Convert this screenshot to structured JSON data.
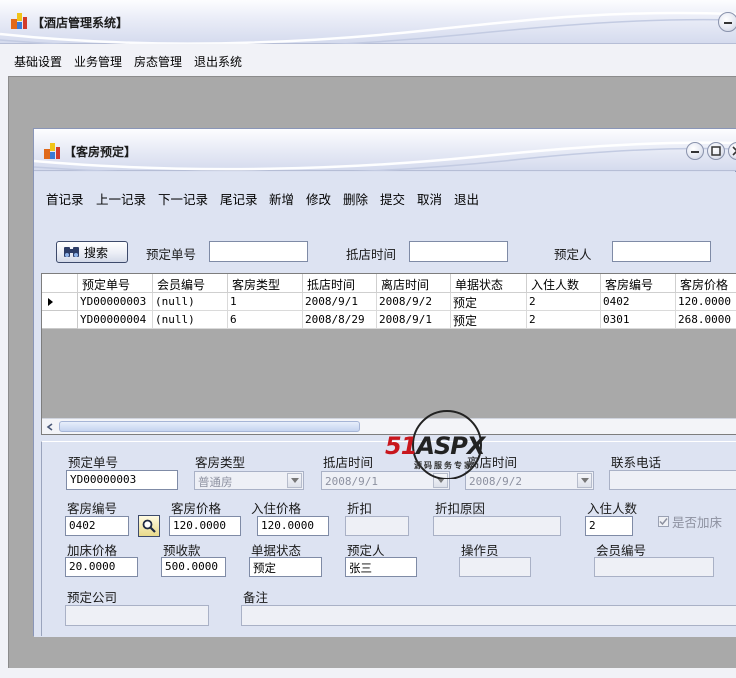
{
  "main_window": {
    "title": "【酒店管理系统】"
  },
  "menu": {
    "items": [
      "基础设置",
      "业务管理",
      "房态管理",
      "退出系统"
    ]
  },
  "child_window": {
    "title": "【客房预定】"
  },
  "toolbar": {
    "items": [
      "首记录",
      "上一记录",
      "下一记录",
      "尾记录",
      "新增",
      "修改",
      "删除",
      "提交",
      "取消",
      "退出"
    ]
  },
  "search": {
    "button_label": "搜索",
    "labels": {
      "booking_no": "预定单号",
      "checkin_time": "抵店时间",
      "booker": "预定人"
    },
    "values": {
      "booking_no": "",
      "checkin_time": "",
      "booker": ""
    }
  },
  "grid": {
    "columns": [
      "预定单号",
      "会员编号",
      "客房类型",
      "抵店时间",
      "离店时间",
      "单据状态",
      "入住人数",
      "客房编号",
      "客房价格"
    ],
    "rows": [
      {
        "cells": [
          "YD00000003",
          "(null)",
          "1",
          "2008/9/1",
          "2008/9/2",
          "预定",
          "2",
          "0402",
          "120.0000"
        ],
        "current": true
      },
      {
        "cells": [
          "YD00000004",
          "(null)",
          "6",
          "2008/8/29",
          "2008/9/1",
          "预定",
          "2",
          "0301",
          "268.0000"
        ],
        "current": false
      }
    ]
  },
  "detail": {
    "booking_no": {
      "label": "预定单号",
      "value": "YD00000003"
    },
    "room_type": {
      "label": "客房类型",
      "value": "普通房"
    },
    "checkin_time": {
      "label": "抵店时间",
      "value": "2008/9/1"
    },
    "checkout_time": {
      "label": "离店时间",
      "value": "2008/9/2"
    },
    "phone": {
      "label": "联系电话",
      "value": ""
    },
    "room_no": {
      "label": "客房编号",
      "value": "0402"
    },
    "room_price": {
      "label": "客房价格",
      "value": "120.0000"
    },
    "checkin_price": {
      "label": "入住价格",
      "value": "120.0000"
    },
    "discount": {
      "label": "折扣",
      "value": ""
    },
    "discount_reason": {
      "label": "折扣原因",
      "value": ""
    },
    "guest_count": {
      "label": "入住人数",
      "value": "2"
    },
    "extra_bed": {
      "label": "是否加床",
      "checked": true
    },
    "extra_bed_price": {
      "label": "加床价格",
      "value": "20.0000"
    },
    "prepaid": {
      "label": "预收款",
      "value": "500.0000"
    },
    "status": {
      "label": "单据状态",
      "value": "预定"
    },
    "booker": {
      "label": "预定人",
      "value": "张三"
    },
    "operator": {
      "label": "操作员",
      "value": ""
    },
    "member_no": {
      "label": "会员编号",
      "value": ""
    },
    "company": {
      "label": "预定公司",
      "value": ""
    },
    "remark": {
      "label": "备注",
      "value": ""
    }
  },
  "watermark": {
    "logo_red": "51",
    "logo_dark": "ASPX",
    "subtitle": "源码服务专家"
  },
  "colors": {
    "mdi_background": "#a9a9a9",
    "panel_background": "#dde3f2",
    "titlebar_highlight": "#d5dbee"
  }
}
